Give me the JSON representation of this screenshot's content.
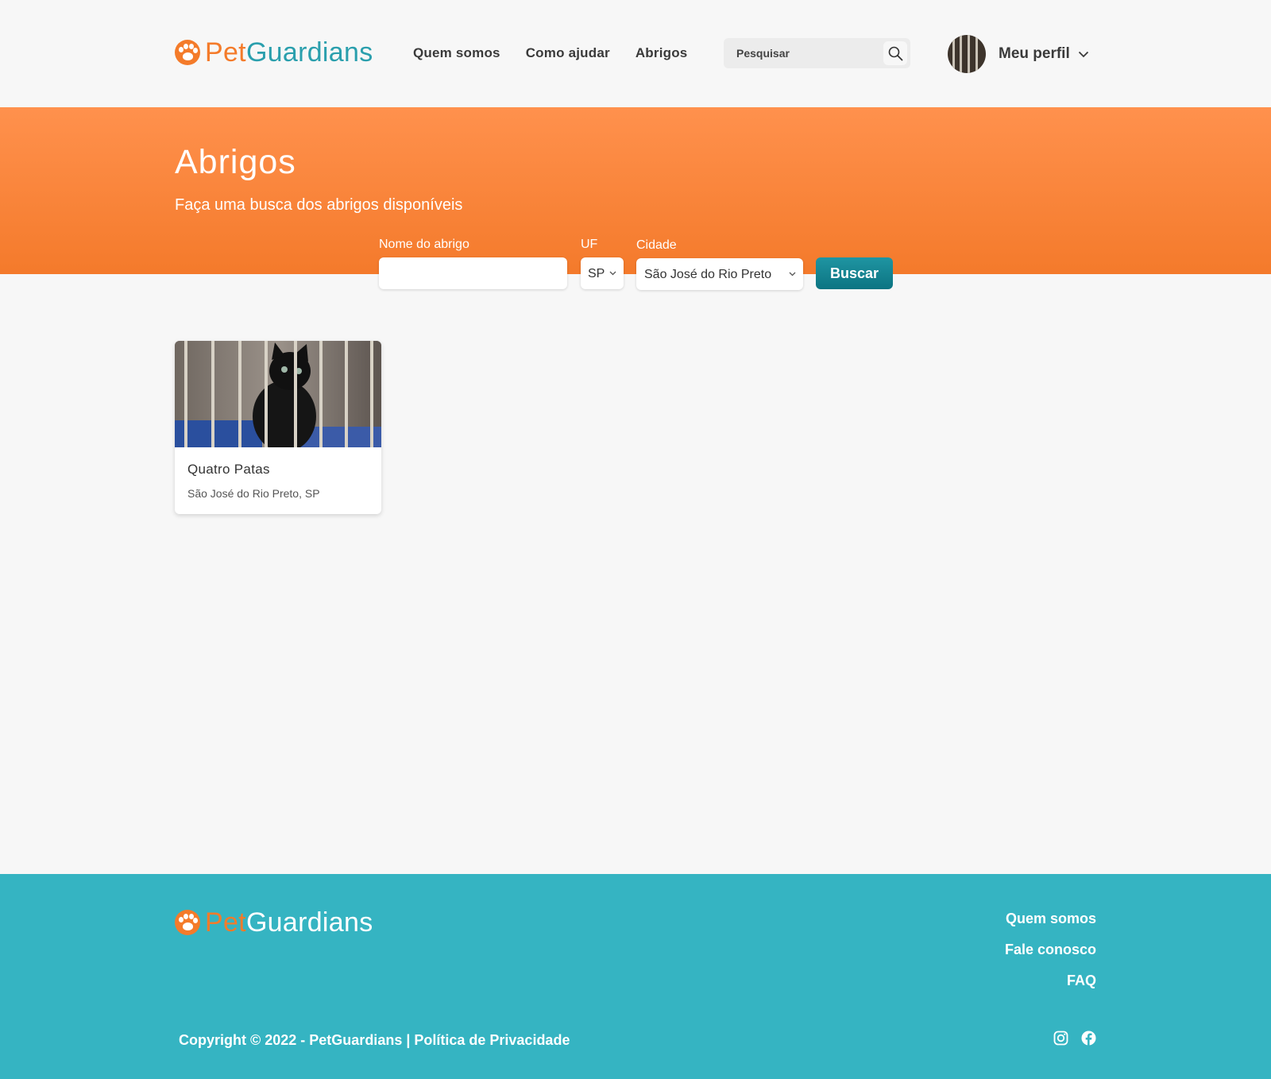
{
  "header": {
    "logo": {
      "part1": "Pet",
      "part2": "Guardians"
    },
    "nav": [
      "Quem somos",
      "Como ajudar",
      "Abrigos"
    ],
    "search": {
      "placeholder": "Pesquisar",
      "icon": "search-icon"
    },
    "profile": {
      "label": "Meu perfil",
      "icon": "chevron-down-icon"
    }
  },
  "banner": {
    "title": "Abrigos",
    "subtitle": "Faça uma busca dos abrigos disponíveis",
    "form": {
      "name_label": "Nome do abrigo",
      "name_value": "",
      "uf_label": "UF",
      "uf_value": "SP",
      "city_label": "Cidade",
      "city_value": "São José do Rio Preto",
      "submit": "Buscar"
    }
  },
  "results": [
    {
      "name": "Quatro Patas",
      "location": "São José do Rio Preto, SP"
    }
  ],
  "footer": {
    "logo": {
      "part1": "Pet",
      "part2": "Guardians"
    },
    "links": [
      "Quem somos",
      "Fale conosco",
      "FAQ"
    ],
    "copyright": "Copyright © 2022 - PetGuardians | Política de Privacidade",
    "social": [
      "instagram-icon",
      "facebook-icon"
    ]
  },
  "colors": {
    "primary_orange": "#f47b2a",
    "teal": "#35b4c2",
    "button_teal": "#0c7482"
  }
}
